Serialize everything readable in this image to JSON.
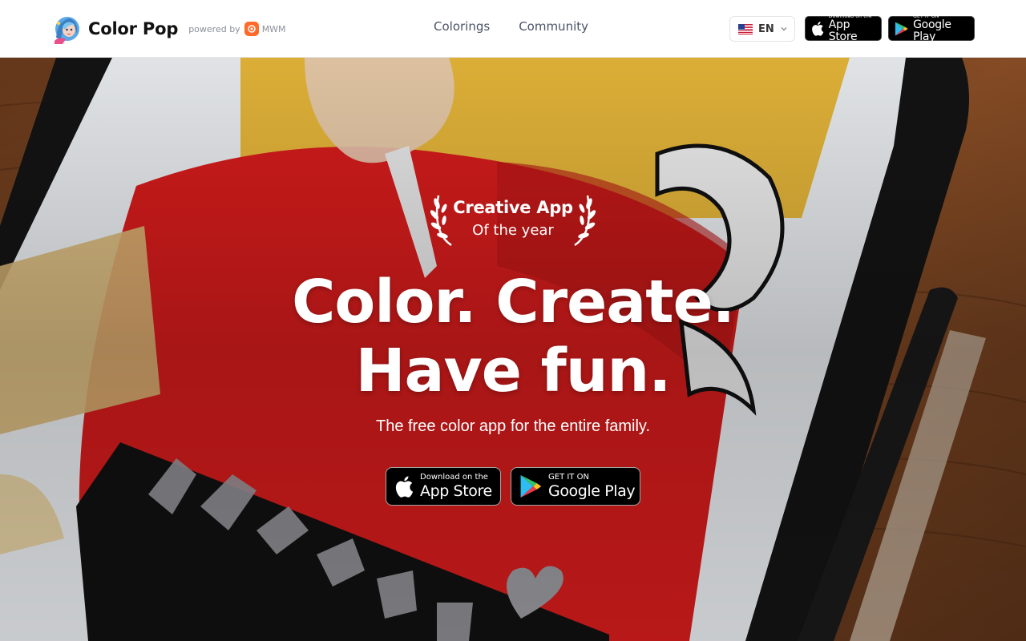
{
  "header": {
    "brand_name": "Color Pop",
    "powered_by": "powered by",
    "partner": "MWM",
    "nav": [
      {
        "label": "Colorings"
      },
      {
        "label": "Community"
      }
    ],
    "language": "EN",
    "app_store": {
      "line1": "Download on the",
      "line2": "App Store"
    },
    "google_play": {
      "line1": "GET IT ON",
      "line2": "Google Play"
    }
  },
  "hero": {
    "award_line1": "Creative App",
    "award_line2": "Of the year",
    "headline_line1": "Color. Create.",
    "headline_line2": "Have fun.",
    "subtitle": "The free color app for the entire family.",
    "app_store": {
      "line1": "Download on the",
      "line2": "App Store"
    },
    "google_play": {
      "line1": "GET IT ON",
      "line2": "Google Play"
    }
  },
  "icons": [
    "apple-icon",
    "google-play-icon",
    "us-flag-icon",
    "chevron-down-icon",
    "laurel-left-icon",
    "laurel-right-icon",
    "mwm-logo-icon"
  ],
  "colors": {
    "accent": "#ff6a2a",
    "text_dark": "#111111",
    "nav_text": "#4a5266"
  }
}
